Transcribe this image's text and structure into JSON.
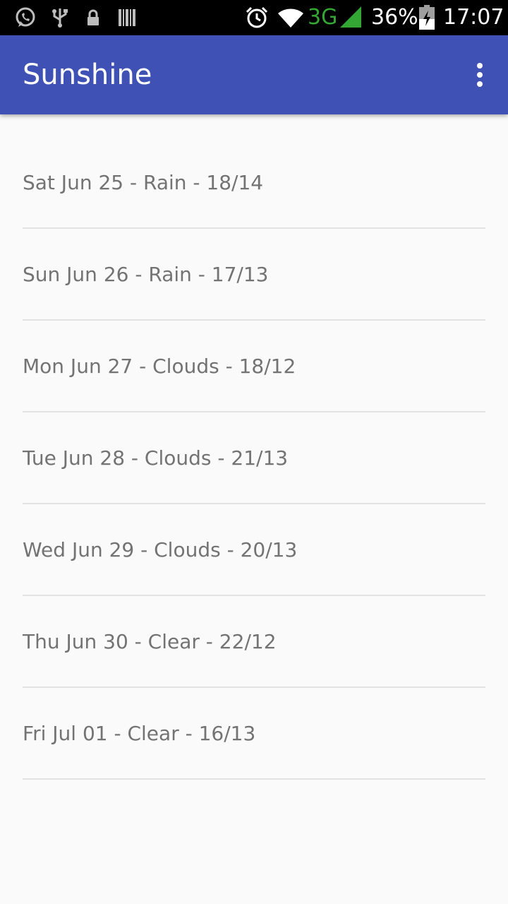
{
  "status_bar": {
    "signal_type": "3G",
    "battery": "36%",
    "time": "17:07",
    "icons": [
      "whatsapp-icon",
      "usb-icon",
      "lock-icon",
      "barcode-icon",
      "alarm-icon",
      "wifi-icon",
      "cell-signal-icon",
      "battery-icon"
    ],
    "signal_color": "#33a633"
  },
  "app_bar": {
    "title": "Sunshine",
    "color": "#3f51b5",
    "menu_icon": "more-vert-icon"
  },
  "forecast": {
    "items": [
      "Sat Jun 25 - Rain - 18/14",
      "Sun Jun 26 - Rain - 17/13",
      "Mon Jun 27 - Clouds - 18/12",
      "Tue Jun 28 - Clouds - 21/13",
      "Wed Jun 29 - Clouds - 20/13",
      "Thu Jun 30 - Clear - 22/12",
      "Fri Jul 01 - Clear - 16/13"
    ]
  }
}
